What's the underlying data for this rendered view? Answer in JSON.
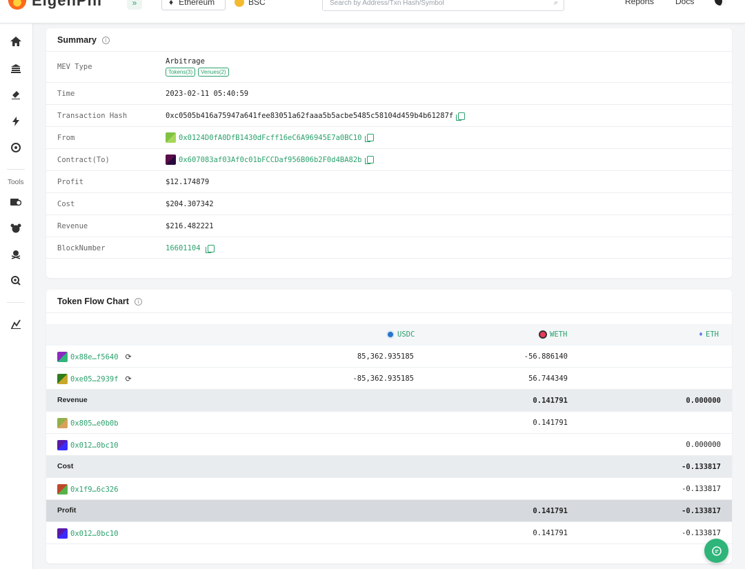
{
  "header": {
    "logo_text": "EigenPhi",
    "chain_selected": "Ethereum",
    "chain_other": "BSC",
    "search_placeholder": "Search by Address/Txn Hash/Symbol",
    "nav": [
      "Reports",
      "Docs"
    ]
  },
  "sidebar": {
    "tools_label": "Tools",
    "icons": [
      "home-icon",
      "bank-icon",
      "sandwich-icon",
      "lightning-icon",
      "radar-icon",
      "wallet-icon",
      "coins-icon",
      "pirate-icon",
      "scan-icon",
      "chart-icon"
    ]
  },
  "summary": {
    "title": "Summary",
    "rows": [
      {
        "label": "MEV Type",
        "value": "Arbitrage",
        "tags": [
          "Tokens(3)",
          "Venues(2)"
        ]
      },
      {
        "label": "Time",
        "value": "2023-02-11 05:40:59"
      },
      {
        "label": "Transaction Hash",
        "value": "0xc0505b416a75947a641fee83051a62faaa5b5acbe5485c58104d459b4b61287f"
      },
      {
        "label": "From",
        "value": "0x0124D0fA0DfB1430dFcff16eC6A96945E7a0BC10"
      },
      {
        "label": "Contract(To)",
        "value": "0x607083af03Af0c01bFCCDaf956B06b2F0d4BA82b"
      },
      {
        "label": "Profit",
        "value": "$12.174879"
      },
      {
        "label": "Cost",
        "value": "$204.307342"
      },
      {
        "label": "Revenue",
        "value": "$216.482221"
      },
      {
        "label": "BlockNumber",
        "value": "16601104"
      }
    ]
  },
  "token_flow": {
    "title": "Token Flow Chart",
    "columns": [
      "USDC",
      "WETH",
      "ETH"
    ],
    "rows": [
      {
        "type": "addr",
        "addr": "0x88e…f5640",
        "swap": true,
        "usdc": "85,362.935185",
        "weth": "-56.886140",
        "eth": ""
      },
      {
        "type": "addr",
        "addr": "0xe05…2939f",
        "swap": true,
        "usdc": "-85,362.935185",
        "weth": "56.744349",
        "eth": ""
      },
      {
        "type": "section",
        "label": "Revenue",
        "usdc": "",
        "weth": "0.141791",
        "eth": "0.000000"
      },
      {
        "type": "addr",
        "addr": "0x805…e0b0b",
        "usdc": "",
        "weth": "0.141791",
        "eth": ""
      },
      {
        "type": "addr",
        "addr": "0x012…0bc10",
        "usdc": "",
        "weth": "",
        "eth": "0.000000"
      },
      {
        "type": "section",
        "label": "Cost",
        "usdc": "",
        "weth": "",
        "eth": "-0.133817"
      },
      {
        "type": "addr",
        "addr": "0x1f9…6c326",
        "usdc": "",
        "weth": "",
        "eth": "-0.133817"
      },
      {
        "type": "profit",
        "label": "Profit",
        "usdc": "",
        "weth": "0.141791",
        "eth": "-0.133817"
      },
      {
        "type": "addr",
        "addr": "0x012…0bc10",
        "usdc": "",
        "weth": "0.141791",
        "eth": "-0.133817"
      }
    ]
  },
  "colors": {
    "accent": "#2aa16c",
    "fab": "#2fb57a"
  }
}
